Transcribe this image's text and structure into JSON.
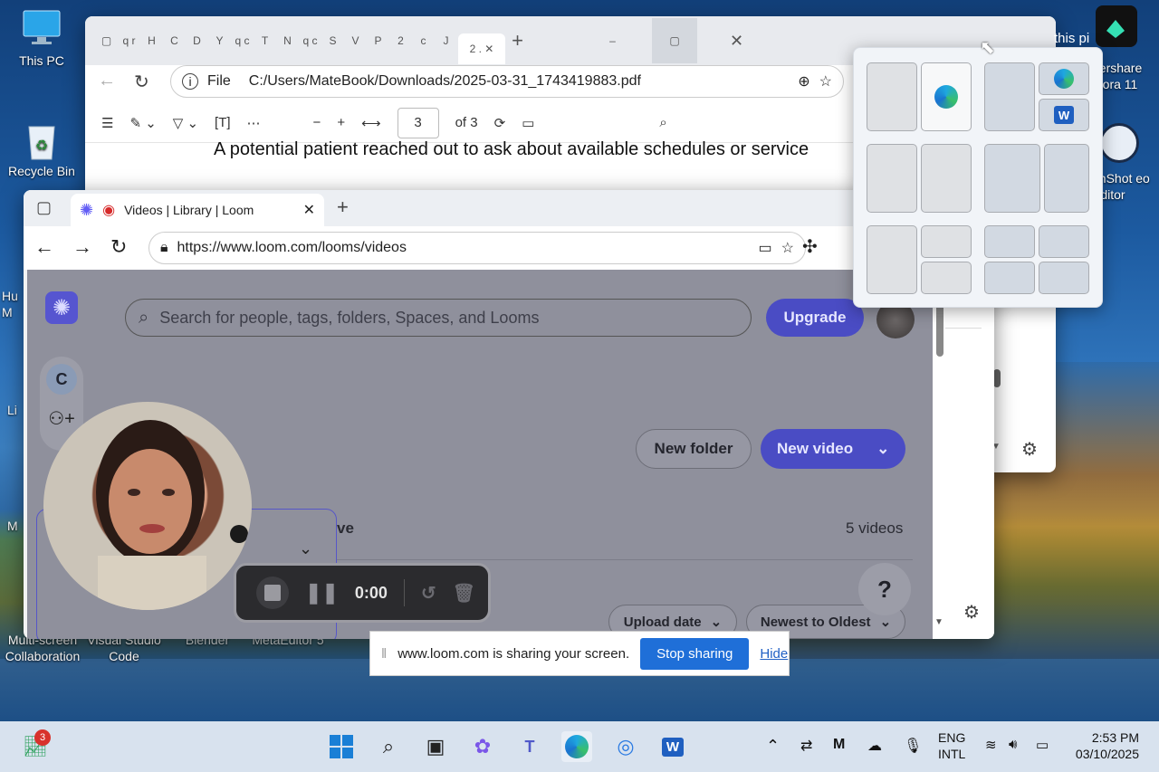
{
  "desktop": {
    "icons": [
      {
        "label": "This PC"
      },
      {
        "label": "Recycle Bin"
      },
      {
        "label": "Hu M"
      },
      {
        "label": "Li"
      },
      {
        "label": "M"
      },
      {
        "label": "Multi-screen Collaboration"
      },
      {
        "label": "Visual Studio Code"
      },
      {
        "label": "Blender"
      },
      {
        "label": "MetaEditor 5"
      },
      {
        "label": "dershare mora 11"
      },
      {
        "label": "enShot eo Editor"
      }
    ],
    "this_pc_peek": "this pi"
  },
  "pdf_window": {
    "tab_labels": [
      "q r",
      "H",
      "C",
      "D",
      "Y",
      "q c",
      "T",
      "N",
      "q c",
      "S",
      "V",
      "P",
      "2",
      "c",
      "J",
      "2 ."
    ],
    "address": "C:/Users/MateBook/Downloads/2025-03-31_1743419883.pdf",
    "file_label": "File",
    "page_current": "3",
    "page_total": "of 3",
    "body_text": "A potential patient reached out to ask about available schedules or service"
  },
  "loom_window": {
    "tab_title": "Videos | Library | Loom",
    "url": "https://www.loom.com/looms/videos",
    "search_placeholder": "Search for people, tags, folders, Spaces, and Looms",
    "upgrade_label": "Upgrade",
    "avatar_letter": "C",
    "new_folder_label": "New folder",
    "new_video_label": "New video",
    "section_partial": "ve",
    "videos_count": "5 videos",
    "sort_date_label": "Upload date",
    "sort_order_label": "Newest to Oldest",
    "help_label": "?"
  },
  "recorder": {
    "timer": "0:00"
  },
  "share_bar": {
    "message": "www.loom.com is sharing your screen.",
    "stop_label": "Stop sharing",
    "hide_label": "Hide"
  },
  "taskbar": {
    "badge_count": "3",
    "lang_line1": "ENG",
    "lang_line2": "INTL",
    "time": "2:53 PM",
    "date": "03/10/2025"
  },
  "colors": {
    "loom_purple": "#4a4cc4",
    "stop_blue": "#1f6fd8",
    "taskbar": "#d8e2ee"
  }
}
